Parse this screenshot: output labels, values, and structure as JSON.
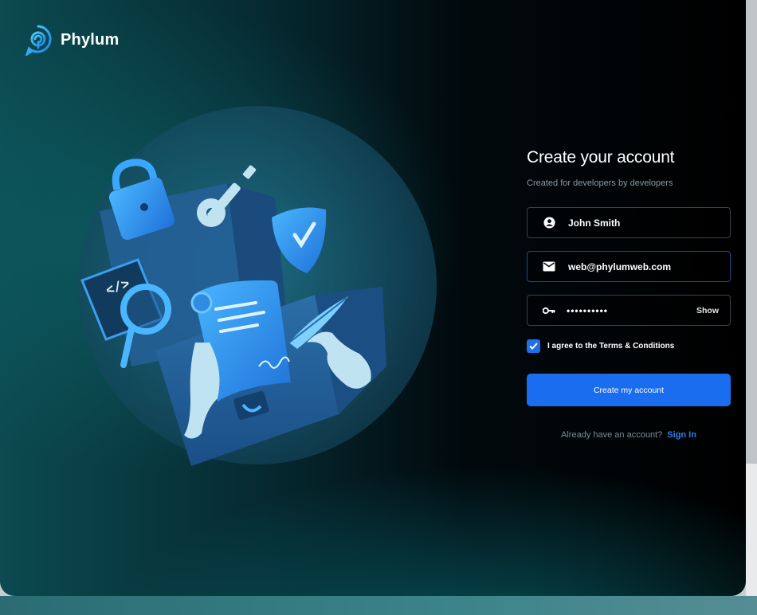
{
  "brand": {
    "name": "Phylum",
    "logo_icon": "phylum-logo-icon",
    "accent": "#2a9df4"
  },
  "form": {
    "title": "Create your account",
    "subtitle": "Created for developers by developers",
    "name_field": {
      "icon": "user-icon",
      "value": "John Smith"
    },
    "email_field": {
      "icon": "mail-icon",
      "value": "web@phylumweb.com"
    },
    "password_field": {
      "icon": "key-icon",
      "value": "••••••••••",
      "show_label": "Show"
    },
    "terms": {
      "checked": true,
      "label": "I agree to the Terms & Conditions"
    },
    "submit_label": "Create my account",
    "signin_prompt": "Already have an account?",
    "signin_link": "Sign In"
  },
  "colors": {
    "primary_button": "#1a6dee",
    "link": "#2a7ef0",
    "background_dark": "#000000",
    "background_teal": "#0b4a50"
  },
  "illustration": {
    "elements": [
      "padlock-icon",
      "key-icon",
      "shield-check-icon",
      "code-tag-icon",
      "magnifier-icon",
      "document-scroll-icon",
      "quill-pen-icon",
      "hands-icon",
      "open-chest-icon"
    ]
  }
}
